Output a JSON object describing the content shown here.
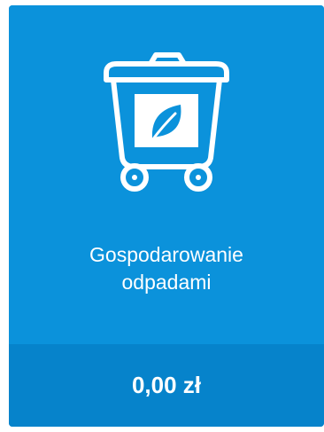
{
  "tile": {
    "icon": "waste-bin-leaf-icon",
    "title_line1": "Gospodarowanie",
    "title_line2": "odpadami",
    "amount": "0,00 zł"
  },
  "colors": {
    "tile_background": "#0b92db",
    "footer_background": "#0683cb",
    "foreground": "#ffffff"
  }
}
